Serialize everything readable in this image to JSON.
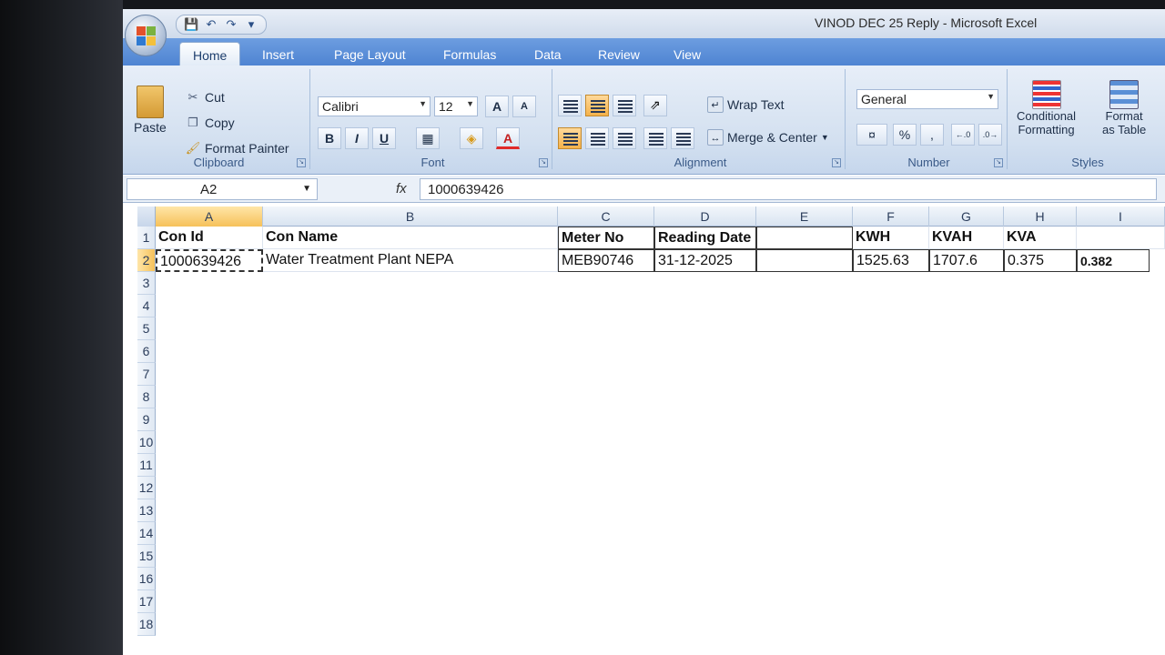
{
  "window": {
    "title": "VINOD DEC 25 Reply - Microsoft Excel"
  },
  "quick_access": {
    "icons": [
      "save-icon",
      "undo-icon",
      "redo-icon",
      "customize-icon"
    ]
  },
  "tabs": [
    {
      "label": "Home",
      "active": true
    },
    {
      "label": "Insert"
    },
    {
      "label": "Page Layout"
    },
    {
      "label": "Formulas"
    },
    {
      "label": "Data"
    },
    {
      "label": "Review"
    },
    {
      "label": "View"
    }
  ],
  "ribbon": {
    "clipboard": {
      "label": "Clipboard",
      "paste": "Paste",
      "cut": "Cut",
      "copy": "Copy",
      "format_painter": "Format Painter"
    },
    "font": {
      "label": "Font",
      "font_name": "Calibri",
      "font_size": "12",
      "bold": "B",
      "italic": "I",
      "underline": "U",
      "grow": "A",
      "shrink": "A",
      "font_color": "A"
    },
    "alignment": {
      "label": "Alignment",
      "wrap_text": "Wrap Text",
      "merge_center": "Merge & Center"
    },
    "number": {
      "label": "Number",
      "format": "General",
      "percent": "%",
      "comma": ","
    },
    "styles": {
      "label": "Styles",
      "conditional_line1": "Conditional",
      "conditional_line2": "Formatting",
      "format_table_line1": "Format",
      "format_table_line2": "as Table"
    }
  },
  "formula_bar": {
    "name_box": "A2",
    "fx": "fx",
    "value": "1000639426"
  },
  "columns": [
    "A",
    "B",
    "C",
    "D",
    "E",
    "F",
    "G",
    "H",
    "I"
  ],
  "rows": [
    "1",
    "2",
    "3",
    "4",
    "5",
    "6",
    "7",
    "8",
    "9",
    "10",
    "11",
    "12",
    "13",
    "14",
    "15",
    "16",
    "17",
    "18"
  ],
  "sheet": {
    "row1": {
      "A": "Con Id",
      "B": "Con Name",
      "C": "Meter No",
      "D": "Reading Date",
      "F": "KWH",
      "G": "KVAH",
      "H": "KVA"
    },
    "row2": {
      "A": "1000639426",
      "B": "Water Treatment Plant NEPA",
      "C": "MEB90746",
      "D": "31-12-2025",
      "F": "1525.63",
      "G": "1707.6",
      "H": "0.375",
      "I": "0.382"
    }
  },
  "colors": {
    "tab_bar": "#4f84d2",
    "selection": "#f6c15a",
    "ribbon": "#d3e0f0"
  }
}
